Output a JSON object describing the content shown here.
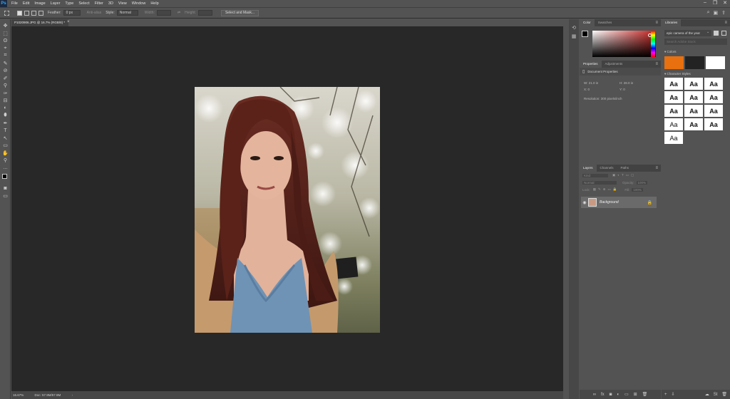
{
  "app": {
    "logo": "Ps"
  },
  "menu": [
    "File",
    "Edit",
    "Image",
    "Layer",
    "Type",
    "Select",
    "Filter",
    "3D",
    "View",
    "Window",
    "Help"
  ],
  "window_controls": [
    "–",
    "❐",
    "✕"
  ],
  "options_bar": {
    "feather_label": "Feather:",
    "feather_value": "0 px",
    "anti_alias": "Anti-alias",
    "style_label": "Style:",
    "style_value": "Normal",
    "width_label": "Width:",
    "height_label": "Height:",
    "select_mask_button": "Select and Mask..."
  },
  "document": {
    "tab_label": "P1020906.JPG @ 16.7% (RGB/8) *",
    "zoom": "16.67%",
    "doc_size": "Doc: 57.9M/57.9M"
  },
  "tools": [
    "✥",
    "⬚",
    "ʘ",
    "⌖",
    "⌗",
    "✎",
    "⊘",
    "✐",
    "⚲",
    "✑",
    "⊟",
    "◐",
    "⬮",
    "✒",
    "T",
    "↖",
    "▭",
    "✋",
    "⚲",
    "…"
  ],
  "color_panel": {
    "tabs": [
      "Color",
      "Swatches"
    ]
  },
  "properties_panel": {
    "tabs": [
      "Properties",
      "Adjustments"
    ],
    "title": "Document Properties",
    "w_label": "W:",
    "w_value": "21.0 in",
    "h_label": "H:",
    "h_value": "28.0 in",
    "x_label": "X:",
    "x_value": "0",
    "y_label": "Y:",
    "y_value": "0",
    "resolution": "Resolution: 300 pixels/inch"
  },
  "layers_panel": {
    "tabs": [
      "Layers",
      "Channels",
      "Paths"
    ],
    "kind": "Kind",
    "blend": "Normal",
    "opacity_label": "Opacity:",
    "opacity_value": "100%",
    "lock_label": "Lock:",
    "fill_label": "Fill:",
    "fill_value": "100%",
    "layer_name": "Background"
  },
  "libraries_panel": {
    "title": "Libraries",
    "library_name": "epic camera of the year",
    "search_placeholder": "Search Adobe Stock",
    "colors_label": "Colors",
    "character_styles_label": "Character Styles",
    "style_sample": "Aa",
    "colors": [
      "#e8700f",
      "#232323",
      "#ffffff"
    ]
  }
}
